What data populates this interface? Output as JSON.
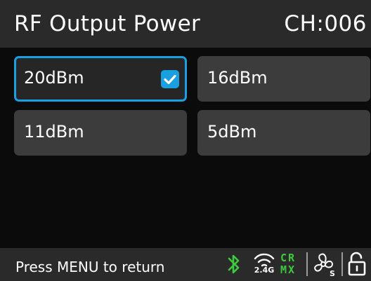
{
  "header": {
    "title": "RF Output Power",
    "channel": "CH:006"
  },
  "options": [
    {
      "label": "20dBm",
      "selected": true
    },
    {
      "label": "16dBm",
      "selected": false
    },
    {
      "label": "11dBm",
      "selected": false
    },
    {
      "label": "5dBm",
      "selected": false
    }
  ],
  "footer": {
    "hint": "Press MENU to return",
    "status_icons": [
      "bluetooth-icon",
      "wireless-2.4g-icon",
      "crmx-icon",
      "fan-icon",
      "unlock-icon"
    ],
    "wireless_band": "2.4G",
    "crmx_line1": "CR",
    "crmx_line2": "MX"
  },
  "colors": {
    "accent": "#1aa0e0",
    "bar": "#2a2a2a",
    "tile": "#3c3c3c",
    "status_green": "#3ec93e"
  }
}
